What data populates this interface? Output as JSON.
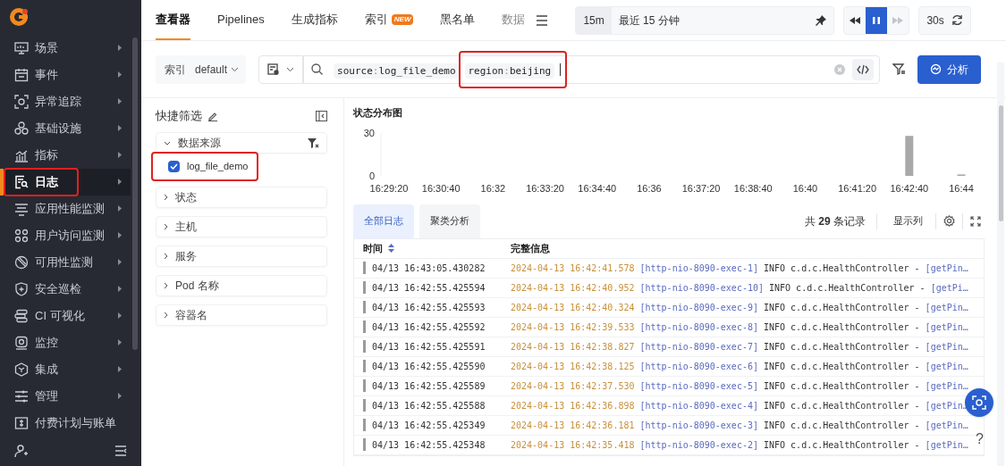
{
  "sidebar": {
    "items": [
      {
        "label": "场景",
        "selected": false,
        "annotated": false,
        "has_submenu": true
      },
      {
        "label": "事件",
        "selected": false,
        "annotated": false,
        "has_submenu": true
      },
      {
        "label": "异常追踪",
        "selected": false,
        "annotated": false,
        "has_submenu": true
      },
      {
        "label": "基础设施",
        "selected": false,
        "annotated": false,
        "has_submenu": true
      },
      {
        "label": "指标",
        "selected": false,
        "annotated": false,
        "has_submenu": true
      },
      {
        "label": "日志",
        "selected": true,
        "annotated": true,
        "has_submenu": true
      },
      {
        "label": "应用性能监测",
        "selected": false,
        "annotated": false,
        "has_submenu": true
      },
      {
        "label": "用户访问监测",
        "selected": false,
        "annotated": false,
        "has_submenu": true
      },
      {
        "label": "可用性监测",
        "selected": false,
        "annotated": false,
        "has_submenu": true
      },
      {
        "label": "安全巡检",
        "selected": false,
        "annotated": false,
        "has_submenu": true
      },
      {
        "label": "CI 可视化",
        "selected": false,
        "annotated": false,
        "has_submenu": true
      },
      {
        "label": "监控",
        "selected": false,
        "annotated": false,
        "has_submenu": true
      },
      {
        "label": "集成",
        "selected": false,
        "annotated": false,
        "has_submenu": true
      },
      {
        "label": "管理",
        "selected": false,
        "annotated": false,
        "has_submenu": true
      },
      {
        "label": "付费计划与账单",
        "selected": false,
        "annotated": false,
        "has_submenu": false
      }
    ]
  },
  "tabs": [
    {
      "label": "查看器",
      "selected": true
    },
    {
      "label": "Pipelines",
      "selected": false
    },
    {
      "label": "生成指标",
      "selected": false
    },
    {
      "label": "索引",
      "selected": false,
      "badge": "NEW"
    },
    {
      "label": "黑名单",
      "selected": false
    },
    {
      "label": "数据",
      "selected": false
    }
  ],
  "time_picker": {
    "short": "15m",
    "range": "最近 15 分钟",
    "interval": "30s"
  },
  "playback": [
    {
      "kind": "rewind",
      "selected": false,
      "disabled": false
    },
    {
      "kind": "pause",
      "selected": true,
      "disabled": false
    },
    {
      "kind": "forward",
      "selected": false,
      "disabled": true
    }
  ],
  "query_bar": {
    "index_label": "索引",
    "index_value": "default",
    "tokens": [
      {
        "key": "source",
        "separator": ":",
        "value": "log_file_demo",
        "annotated": false
      },
      {
        "key": "region",
        "separator": ":",
        "value": "beijing",
        "annotated": true
      }
    ],
    "button": "分析"
  },
  "quick_filter": {
    "title": "快捷筛选",
    "groups": [
      {
        "label": "数据来源",
        "expanded": true,
        "options": [
          {
            "label": "log_file_demo",
            "checked": true,
            "annotated": true
          }
        ]
      },
      {
        "label": "状态",
        "expanded": false
      },
      {
        "label": "主机",
        "expanded": false
      },
      {
        "label": "服务",
        "expanded": false
      },
      {
        "label": "Pod 名称",
        "expanded": false
      },
      {
        "label": "容器名",
        "expanded": false
      }
    ]
  },
  "chart": {
    "title": "状态分布图",
    "chart_data": {
      "type": "bar",
      "categories": [
        "16:29:20",
        "16:30:40",
        "16:32",
        "16:33:20",
        "16:34:40",
        "16:36",
        "16:37:20",
        "16:38:40",
        "16:40",
        "16:41:20",
        "16:42:40",
        "16:44"
      ],
      "values": [
        0,
        0,
        0,
        0,
        0,
        0,
        0,
        0,
        0,
        0,
        28,
        1
      ],
      "yticks": [
        0,
        30
      ],
      "ylim": [
        0,
        30
      ]
    }
  },
  "log_tabs": [
    {
      "label": "全部日志",
      "selected": true
    },
    {
      "label": "聚类分析",
      "selected": false
    }
  ],
  "record_count": "共 **29** 条记录",
  "columns_button": "显示列",
  "table": {
    "columns": [
      "时间",
      "完整信息"
    ],
    "rows": [
      {
        "time": "04/13 16:43:05.430282",
        "stamp": "2024-04-13 16:42:41.578",
        "thread": "[http-nio-8090-exec-1]",
        "body": "INFO c.d.c.HealthController -",
        "method": "[getPin…"
      },
      {
        "time": "04/13 16:42:55.425594",
        "stamp": "2024-04-13 16:42:40.952",
        "thread": "[http-nio-8090-exec-10]",
        "body": "INFO c.d.c.HealthController -",
        "method": "[getPi…"
      },
      {
        "time": "04/13 16:42:55.425593",
        "stamp": "2024-04-13 16:42:40.324",
        "thread": "[http-nio-8090-exec-9]",
        "body": "INFO c.d.c.HealthController -",
        "method": "[getPin…"
      },
      {
        "time": "04/13 16:42:55.425592",
        "stamp": "2024-04-13 16:42:39.533",
        "thread": "[http-nio-8090-exec-8]",
        "body": "INFO c.d.c.HealthController -",
        "method": "[getPin…"
      },
      {
        "time": "04/13 16:42:55.425591",
        "stamp": "2024-04-13 16:42:38.827",
        "thread": "[http-nio-8090-exec-7]",
        "body": "INFO c.d.c.HealthController -",
        "method": "[getPin…"
      },
      {
        "time": "04/13 16:42:55.425590",
        "stamp": "2024-04-13 16:42:38.125",
        "thread": "[http-nio-8090-exec-6]",
        "body": "INFO c.d.c.HealthController -",
        "method": "[getPin…"
      },
      {
        "time": "04/13 16:42:55.425589",
        "stamp": "2024-04-13 16:42:37.530",
        "thread": "[http-nio-8090-exec-5]",
        "body": "INFO c.d.c.HealthController -",
        "method": "[getPin…"
      },
      {
        "time": "04/13 16:42:55.425588",
        "stamp": "2024-04-13 16:42:36.898",
        "thread": "[http-nio-8090-exec-4]",
        "body": "INFO c.d.c.HealthController -",
        "method": "[getPin…"
      },
      {
        "time": "04/13 16:42:55.425349",
        "stamp": "2024-04-13 16:42:36.181",
        "thread": "[http-nio-8090-exec-3]",
        "body": "INFO c.d.c.HealthController -",
        "method": "[getPin…"
      },
      {
        "time": "04/13 16:42:55.425348",
        "stamp": "2024-04-13 16:42:35.418",
        "thread": "[http-nio-8090-exec-2]",
        "body": "INFO c.d.c.HealthController -",
        "method": "[getPin…"
      }
    ]
  },
  "help": "?"
}
